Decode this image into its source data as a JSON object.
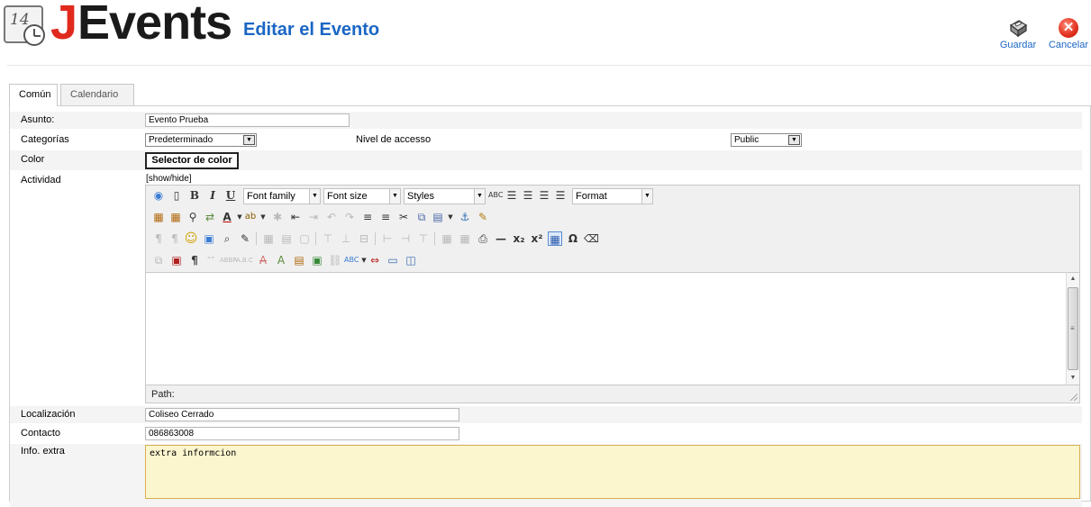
{
  "header": {
    "logo_calendar_number": "14",
    "logo_j": "J",
    "logo_rest": "Events",
    "page_title": "Editar el Evento",
    "save_label": "Guardar",
    "cancel_label": "Cancelar"
  },
  "tabs": [
    {
      "label": "Común",
      "active": true
    },
    {
      "label": "Calendario",
      "active": false
    }
  ],
  "form": {
    "subject_label": "Asunto:",
    "subject_value": "Evento Prueba",
    "categories_label": "Categorías",
    "categories_value": "Predeterminado",
    "access_label": "Nivel de accesso",
    "access_value": "Public",
    "color_label": "Color",
    "color_button": "Selector de color",
    "activity_label": "Actividad",
    "show_hide": "[show/hide]",
    "location_label": "Localización",
    "location_value": "Coliseo Cerrado",
    "contact_label": "Contacto",
    "contact_value": "086863008",
    "extra_label": "Info. extra",
    "extra_value": "extra informcion"
  },
  "editor": {
    "font_family": "Font family",
    "font_size": "Font size",
    "styles": "Styles",
    "format": "Format",
    "path_label": "Path:"
  },
  "colors": {
    "brand_red": "#e02a1d",
    "title_blue": "#1b66c4",
    "extra_field_bg": "#fcf6cf"
  }
}
